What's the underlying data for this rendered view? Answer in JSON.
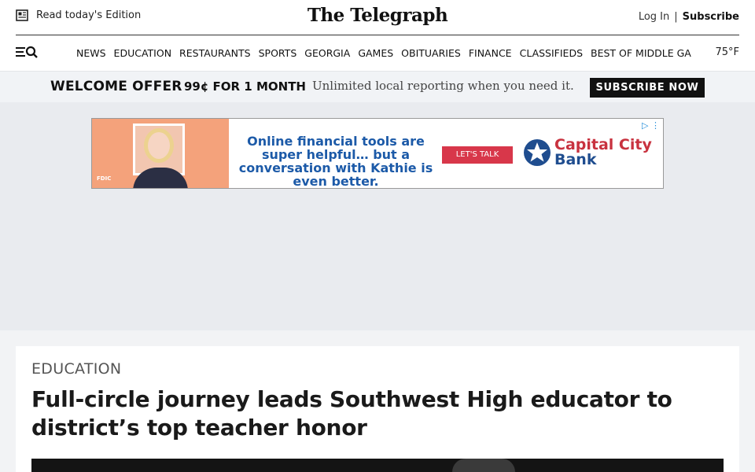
{
  "header": {
    "edition_label": "Read today's Edition",
    "logo": "The Telegraph",
    "login": "Log In",
    "separator": "|",
    "subscribe": "Subscribe"
  },
  "nav": {
    "items": [
      "NEWS",
      "EDUCATION",
      "RESTAURANTS",
      "SPORTS",
      "GEORGIA",
      "GAMES",
      "OBITUARIES",
      "FINANCE",
      "CLASSIFIEDS",
      "BEST OF MIDDLE GA"
    ],
    "temperature": "75°F"
  },
  "offer": {
    "title": "WELCOME OFFER",
    "price": "99¢ FOR 1 MONTH",
    "tagline": "Unlimited local reporting when you need it.",
    "button": "SUBSCRIBE NOW"
  },
  "ad": {
    "headline": "Online financial tools are super helpful… but a conversation with Kathie is even better.",
    "cta": "LET'S TALK",
    "brand_line1": "Capital City",
    "brand_line2": "Bank",
    "small_text": "FDIC"
  },
  "article": {
    "section": "EDUCATION",
    "headline": "Full-circle journey leads Southwest High educator to district’s top teacher honor"
  },
  "colors": {
    "offer_bg": "#f1f3f6",
    "ad_region_bg": "#e9ebef",
    "ad_headline": "#1c5aa8",
    "ad_cta": "#d8374a",
    "brand_red": "#c8323f"
  }
}
